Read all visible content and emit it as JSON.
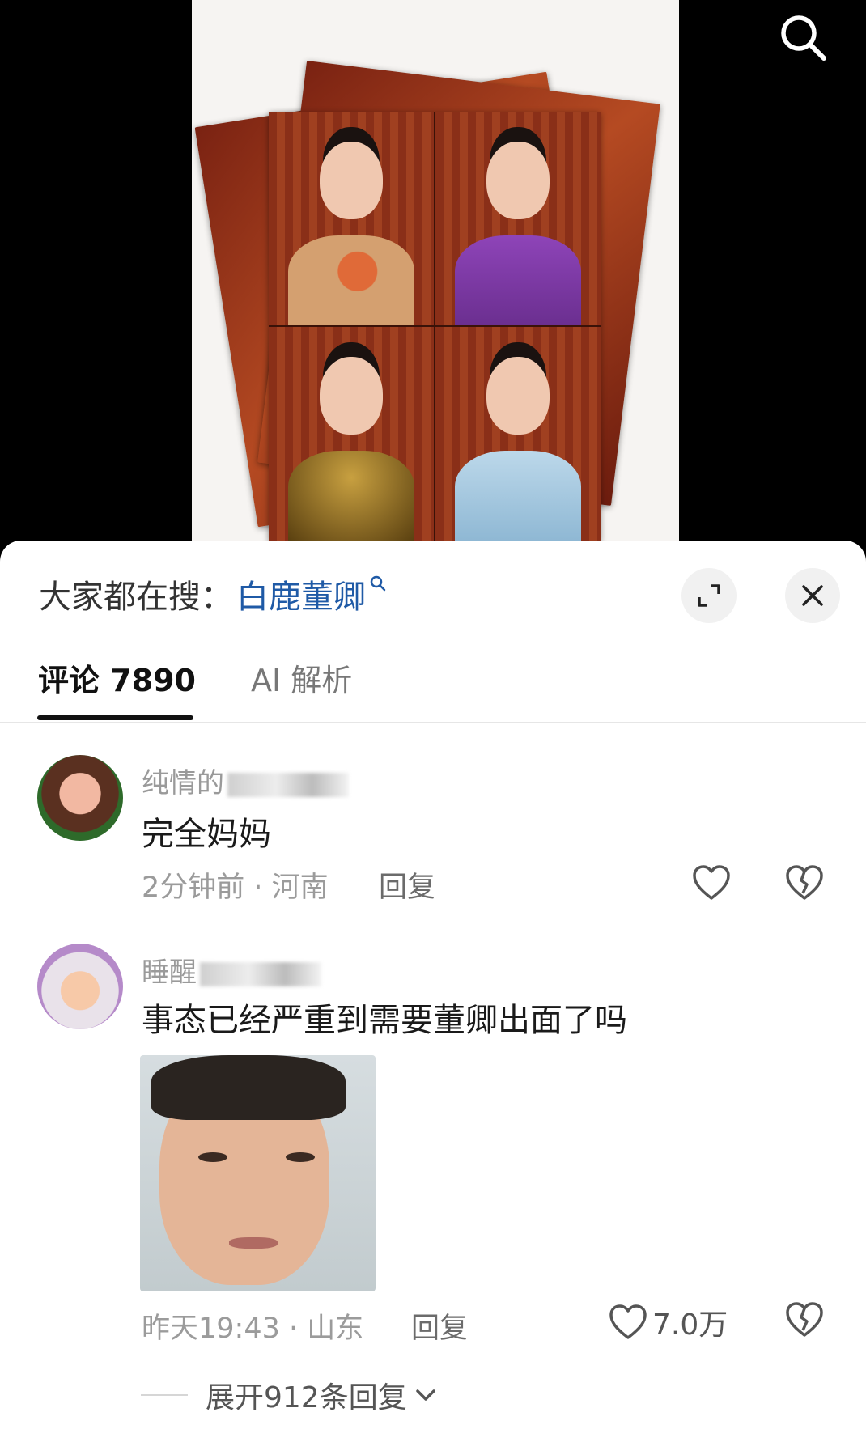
{
  "search": {
    "icon": "search-icon"
  },
  "trending": {
    "prefix": "大家都在搜：",
    "keyword": "白鹿董卿"
  },
  "tabs": [
    {
      "label": "评论 7890"
    },
    {
      "label": "AI 解析"
    }
  ],
  "comments": [
    {
      "username": "纯情的",
      "text": "完全妈妈",
      "time": "2分钟前",
      "location": "河南",
      "meta": "2分钟前 · 河南",
      "reply_label": "回复",
      "likes": ""
    },
    {
      "username": "睡醒",
      "text": "事态已经严重到需要董卿出面了吗",
      "time": "昨天19:43",
      "location": "山东",
      "meta": "昨天19:43 · 山东",
      "reply_label": "回复",
      "likes": "7.0万",
      "expand_replies": "展开912条回复"
    }
  ],
  "colors": {
    "accent": "#1f5aa6",
    "text": "#1a1a1a",
    "muted": "#9b9b9b"
  }
}
